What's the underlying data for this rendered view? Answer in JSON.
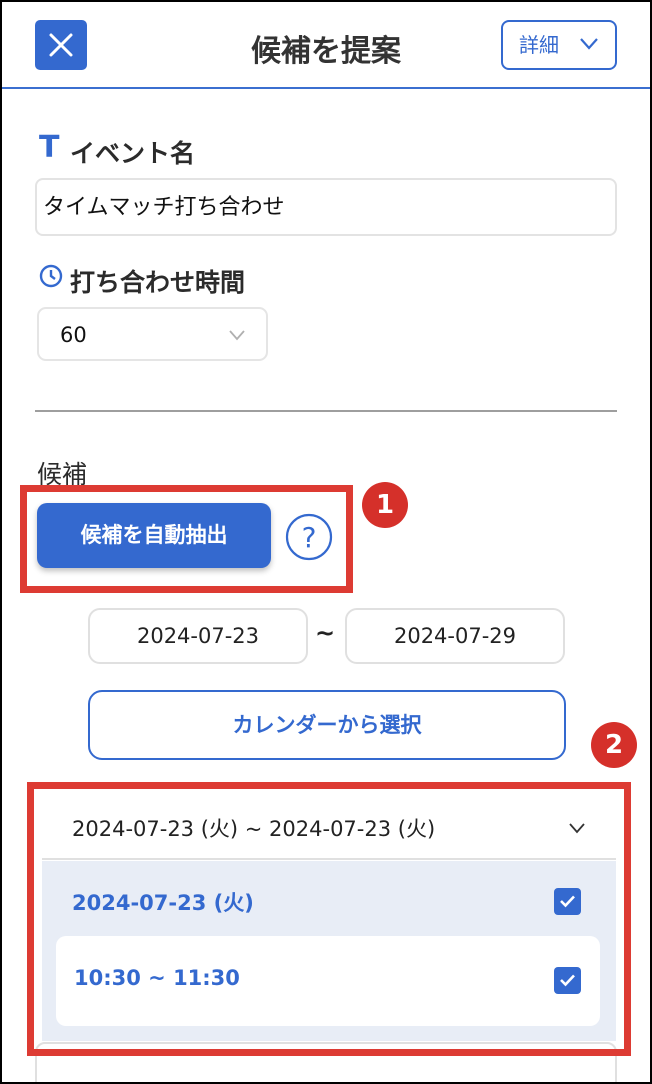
{
  "header": {
    "title": "候補を提案",
    "detail_label": "詳細"
  },
  "event": {
    "label": "イベント名",
    "icon_glyph": "T",
    "value": "タイムマッチ打ち合わせ"
  },
  "duration": {
    "label": "打ち合わせ時間",
    "value": "60"
  },
  "candidates": {
    "label": "候補",
    "auto_button": "候補を自動抽出",
    "help_glyph": "?",
    "start_date": "2024-07-23",
    "range_sep": "~",
    "end_date": "2024-07-29",
    "calendar_button": "カレンダーから選択",
    "range_summary": "2024-07-23 (火) ~ 2024-07-23 (火)",
    "day_label": "2024-07-23 (火)",
    "slot_label": "10:30 ~ 11:30"
  },
  "annotations": {
    "badge1": "1",
    "badge2": "2"
  },
  "colors": {
    "accent": "#3469cf",
    "highlight": "#dd3b33"
  }
}
